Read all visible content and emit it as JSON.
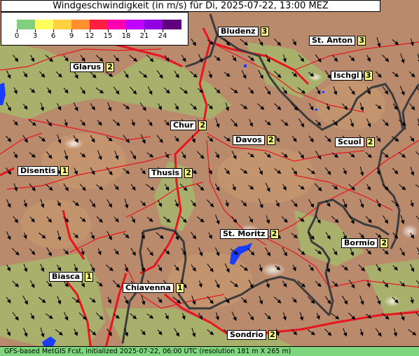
{
  "title": "Windgeschwindigkeit (in m/s) für Di, 2025-07-22, 13:00 MEZ",
  "legend": {
    "ticks": [
      "0",
      "3",
      "6",
      "9",
      "12",
      "15",
      "18",
      "21",
      "24"
    ],
    "colors": [
      "#80d080",
      "#ffff60",
      "#ffd040",
      "#ff9030",
      "#ff2040",
      "#ff00b0",
      "#c000ff",
      "#9000e0",
      "#600080"
    ]
  },
  "locations": [
    {
      "name": "Bludenz",
      "value": "3"
    },
    {
      "name": "St. Anton",
      "value": "3"
    },
    {
      "name": "Glarus",
      "value": "2"
    },
    {
      "name": "Ischgl",
      "value": "3"
    },
    {
      "name": "Chur",
      "value": "2"
    },
    {
      "name": "Davos",
      "value": "2"
    },
    {
      "name": "Scuol",
      "value": "2"
    },
    {
      "name": "Disentis",
      "value": "1"
    },
    {
      "name": "Thusis",
      "value": "2"
    },
    {
      "name": "St. Moritz",
      "value": "2"
    },
    {
      "name": "Bormio",
      "value": "2"
    },
    {
      "name": "Biasca",
      "value": "1"
    },
    {
      "name": "Chiavenna",
      "value": "1"
    },
    {
      "name": "Sondrio",
      "value": "2"
    }
  ],
  "footer": {
    "text": "GFS-based MetGIS Fcst, initialized 2025-07-22, 06:00 UTC  (resolution 181 m X 265 m)"
  },
  "colors": {
    "terrain": "#b98a6c",
    "roads": "#e8141e",
    "borders": "#3c3c3c",
    "lakes": "#1a3cff",
    "valley_green": "#9cb86a"
  }
}
